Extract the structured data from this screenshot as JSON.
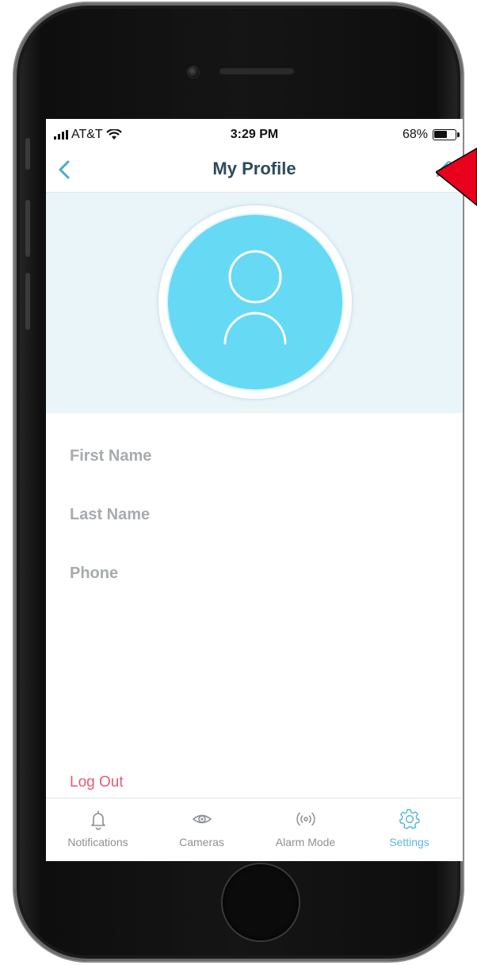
{
  "status_bar": {
    "carrier": "AT&T",
    "time": "3:29 PM",
    "battery_percent_text": "68%",
    "battery_level": 0.68
  },
  "nav": {
    "title": "My Profile",
    "back_icon": "chevron-left-icon",
    "edit_icon": "pencil-icon"
  },
  "profile": {
    "avatar_icon": "user-avatar-icon",
    "fields": [
      {
        "label": "First Name"
      },
      {
        "label": "Last Name"
      },
      {
        "label": "Phone"
      }
    ]
  },
  "logout_label": "Log Out",
  "tabs": [
    {
      "label": "Notifications",
      "icon": "bell-icon",
      "active": false
    },
    {
      "label": "Cameras",
      "icon": "eye-icon",
      "active": false
    },
    {
      "label": "Alarm Mode",
      "icon": "broadcast-icon",
      "active": false
    },
    {
      "label": "Settings",
      "icon": "gear-icon",
      "active": true
    }
  ],
  "colors": {
    "accent": "#5cb9d8",
    "title_text": "#2d4a5c",
    "avatar_fill": "#66d9f5",
    "header_bg": "#eaf5f9",
    "field_label": "#a7abae",
    "logout": "#e85a72",
    "annotation": "#e8001c"
  }
}
